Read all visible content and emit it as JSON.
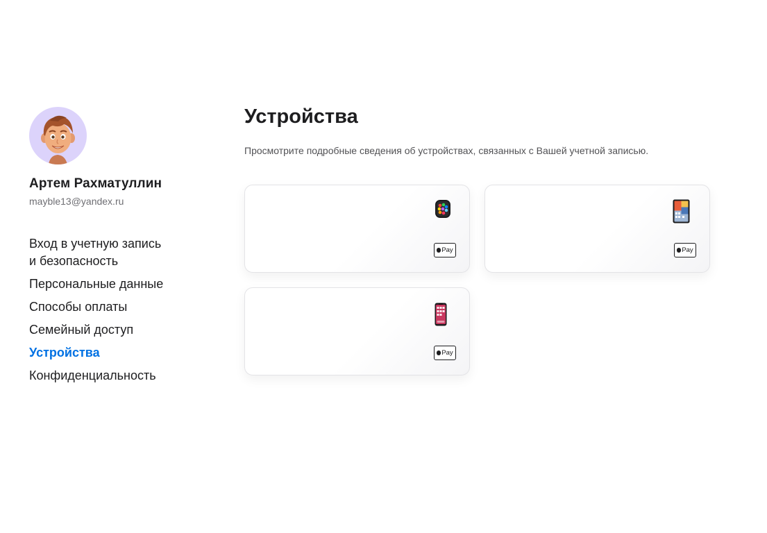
{
  "user": {
    "name": "Артем Рахматуллин",
    "email": "mayble13@yandex.ru"
  },
  "sidebar": {
    "items": [
      {
        "lines": [
          "Вход в учетную запись",
          "и безопасность"
        ],
        "active": false
      },
      {
        "lines": [
          "Персональные данные"
        ],
        "active": false
      },
      {
        "lines": [
          "Способы оплаты"
        ],
        "active": false
      },
      {
        "lines": [
          "Семейный доступ"
        ],
        "active": false
      },
      {
        "lines": [
          "Устройства"
        ],
        "active": true
      },
      {
        "lines": [
          "Конфиденциальность"
        ],
        "active": false
      }
    ]
  },
  "main": {
    "title": "Устройства",
    "subtitle": "Просмотрите подробные сведения об устройствах, связанных с Вашей учетной записью."
  },
  "devices": [
    {
      "icon": "apple-watch-icon",
      "payment": "Pay"
    },
    {
      "icon": "ipad-icon",
      "payment": "Pay"
    },
    {
      "icon": "iphone-icon",
      "payment": "Pay"
    }
  ],
  "colors": {
    "accent": "#0071e3",
    "text": "#1d1d1f",
    "secondary_text": "#6e6e73",
    "avatar_bg": "#dcd3fb"
  }
}
